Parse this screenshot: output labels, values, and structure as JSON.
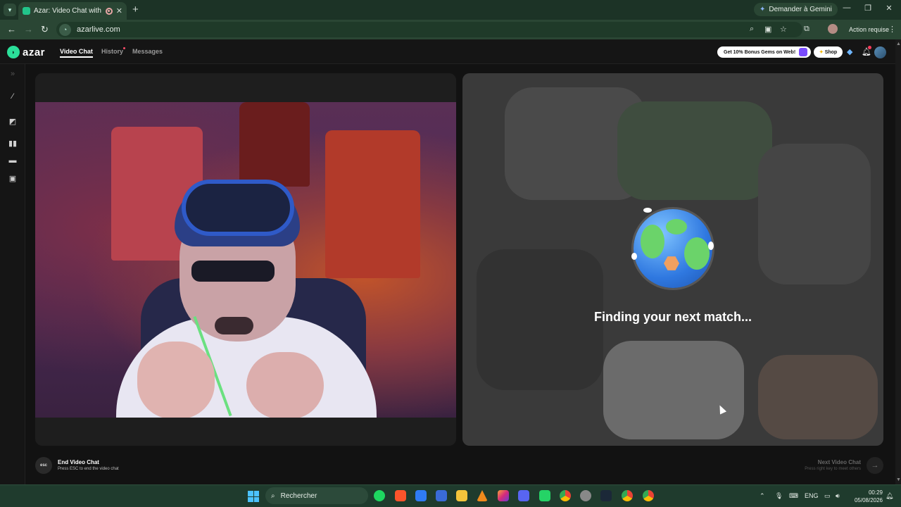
{
  "browser": {
    "tab_title": "Azar: Video Chat with New",
    "new_tab": "+",
    "gemini_label": "Demander à Gemini",
    "url": "azarlive.com",
    "action_label": "Action requise"
  },
  "app": {
    "logo_text": "azar",
    "nav": [
      "Video Chat",
      "History",
      "Messages"
    ],
    "promo_label": "Get 10% Bonus Gems on Web!",
    "shop_label": "Shop"
  },
  "right_panel": {
    "finding_text": "Finding your next match..."
  },
  "footer": {
    "esc_key": "esc",
    "end_title": "End Video Chat",
    "end_subtitle": "Press ESC to end the video chat",
    "next_title": "Next Video Chat",
    "next_subtitle": "Press right key to meet others"
  },
  "taskbar": {
    "search_label": "Rechercher",
    "lang": "ENG",
    "time": "00:29",
    "date": "05/08/2026"
  },
  "colors": {
    "browser_frame": "#1c3326",
    "brand": "#2be09a",
    "app_bg": "#121212"
  }
}
